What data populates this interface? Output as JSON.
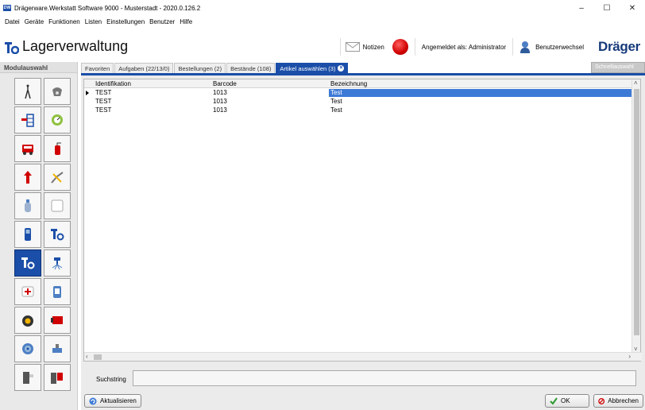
{
  "window": {
    "app_icon_text": "DW",
    "title": "Drägerware.Werkstatt Software 9000 - Musterstadt - 2020.0.126.2",
    "controls": [
      "–",
      "☐",
      "✕"
    ]
  },
  "menu": [
    "Datei",
    "Geräte",
    "Funktionen",
    "Listen",
    "Einstellungen",
    "Benutzer",
    "Hilfe"
  ],
  "header": {
    "title": "Lagerverwaltung",
    "notes_label": "Notizen",
    "logged_in": "Angemeldet als: Administrator",
    "switch_user": "Benutzerwechsel",
    "brand": "Dräger",
    "status_color": "#d00000"
  },
  "left_panel": {
    "title": "Modulauswahl",
    "modules": [
      "person-icon",
      "mask-icon",
      "shelf-icon",
      "gauge-icon",
      "truck-icon",
      "extinguisher-icon",
      "hydrant-icon",
      "hose-icon",
      "bottle-icon",
      "blank-icon",
      "gas-detector-icon",
      "lager-icon",
      "lager-active-icon",
      "sprinkler-icon",
      "first-aid-icon",
      "device-icon",
      "pump-icon",
      "red-box-icon",
      "coil-icon",
      "valve-icon",
      "door-icon",
      "doors-icon"
    ],
    "active_index": 12
  },
  "tabs": [
    {
      "label": "Favoriten"
    },
    {
      "label": "Aufgaben (22/13/0)"
    },
    {
      "label": "Bestellungen (2)"
    },
    {
      "label": "Bestände (108)"
    },
    {
      "label": "Artikel auswählen (3)",
      "active": true
    }
  ],
  "quick_search": "Schnellauswahl",
  "grid": {
    "columns": [
      "Identifikation",
      "Barcode",
      "Bezeichnung"
    ],
    "rows": [
      [
        "TEST",
        "1013",
        "Test"
      ],
      [
        "TEST",
        "1013",
        "Test"
      ],
      [
        "TEST",
        "1013",
        "Test"
      ]
    ],
    "selected_row": 0
  },
  "search": {
    "label": "Suchstring",
    "value": ""
  },
  "buttons": {
    "refresh": "Aktualisieren",
    "ok": "OK",
    "cancel": "Abbrechen"
  },
  "colors": {
    "accent": "#1a4ea8",
    "selection": "#3d7ad6"
  }
}
